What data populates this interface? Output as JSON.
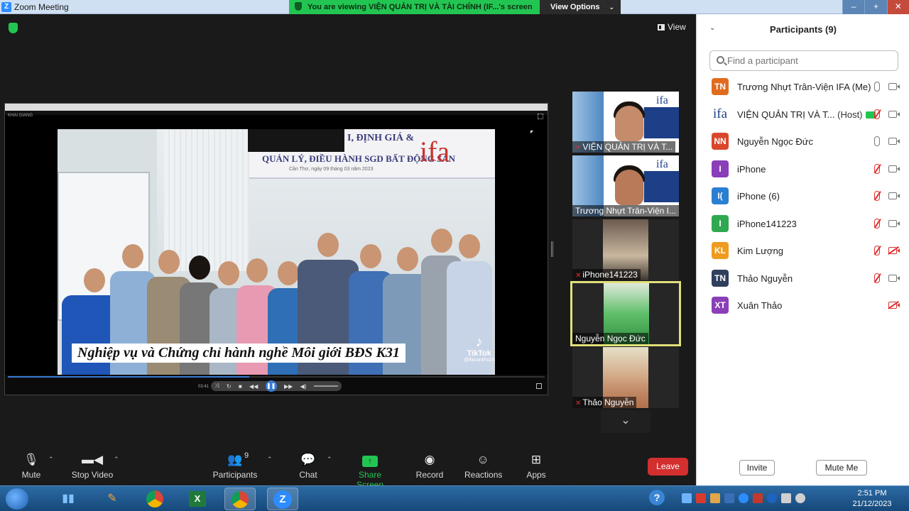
{
  "window": {
    "title": "Zoom Meeting",
    "app_icon": "Z",
    "viewing_banner": "You are viewing VIỆN QUẢN TRỊ VÀ TÀI CHÍNH (IF...'s screen",
    "view_options_label": "View Options",
    "controls": [
      "–",
      "+",
      "✕"
    ]
  },
  "meeting": {
    "view_label": "View"
  },
  "shared_screen": {
    "window_label": "KHAI GIANG",
    "banner_line1": "I, ĐỊNH GIÁ &",
    "banner_line2": "QUẢN LÝ, ĐIỀU HÀNH SGD BẤT ĐỘNG SẢN",
    "banner_line3": "Cần Thơ, ngày 09 tháng 03 năm 2023",
    "logo_text": "ifa",
    "caption": "Nghiệp vụ và Chứng chỉ hành nghề Môi giới BĐS K31",
    "tiktok_brand": "TikTok",
    "tiktok_handle": "@ifacantho24",
    "time": "03:41",
    "progress": 0.45
  },
  "thumbnails": [
    {
      "label": "VIỆN QUẢN TRỊ VÀ T...",
      "muted": true
    },
    {
      "label": "Trương Nhựt Trân-Viện I...",
      "muted": false
    },
    {
      "label": "iPhone141223",
      "muted": true
    },
    {
      "label": "Nguyễn Ngọc Đức",
      "muted": false
    },
    {
      "label": "Thảo Nguyễn",
      "muted": true
    }
  ],
  "toolbar": {
    "mute": "Mute",
    "stop_video": "Stop Video",
    "participants": "Participants",
    "participants_count": "9",
    "chat": "Chat",
    "share_screen": "Share Screen",
    "record": "Record",
    "reactions": "Reactions",
    "apps": "Apps",
    "leave": "Leave"
  },
  "panel": {
    "title": "Participants (9)",
    "search_placeholder": "Find a participant",
    "participants": [
      {
        "initials": "TN",
        "name": "Trương Nhựt Trân-Viện IFA (Me)",
        "color": "#e06b1f",
        "mic": "on",
        "cam": "on"
      },
      {
        "initials": "ifa",
        "name": "VIỆN QUẢN TRỊ VÀ T...",
        "host": "(Host)",
        "color": "logo",
        "mic": "off",
        "cam": "on",
        "sharing": true
      },
      {
        "initials": "NN",
        "name": "Nguyễn Ngọc Đức",
        "color": "#d9472b",
        "mic": "on",
        "cam": "on"
      },
      {
        "initials": "I",
        "name": "iPhone",
        "color": "#8a3fb8",
        "mic": "off",
        "cam": "on"
      },
      {
        "initials": "I(",
        "name": "iPhone (6)",
        "color": "#2b7fd0",
        "mic": "off",
        "cam": "on"
      },
      {
        "initials": "I",
        "name": "iPhone141223",
        "color": "#2fa84f",
        "mic": "off",
        "cam": "on"
      },
      {
        "initials": "KL",
        "name": "Kim Lượng",
        "color": "#ef9b1f",
        "mic": "off",
        "cam": "off"
      },
      {
        "initials": "TN",
        "name": "Thảo Nguyễn",
        "color": "#2f3f5c",
        "mic": "off",
        "cam": "on"
      },
      {
        "initials": "XT",
        "name": "Xuân Thảo",
        "color": "#8a3fb8",
        "mic": "none",
        "cam": "off"
      }
    ],
    "invite": "Invite",
    "mute_me": "Mute Me"
  },
  "taskbar": {
    "time": "2:51 PM",
    "date": "21/12/2023"
  }
}
